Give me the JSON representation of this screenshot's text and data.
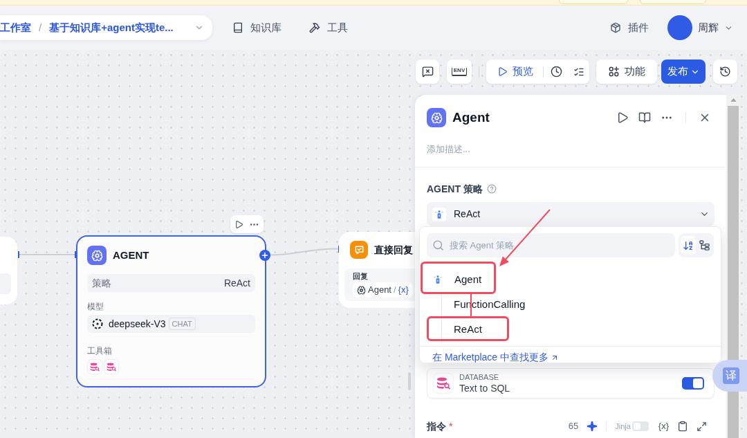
{
  "header": {
    "breadcrumb": [
      {
        "label": "工作室"
      },
      {
        "label": "基于知识库+agent实现te..."
      }
    ],
    "separator": "/",
    "nav": [
      {
        "label": "知识库"
      },
      {
        "label": "工具"
      }
    ],
    "plugins": {
      "label": "插件"
    },
    "user": {
      "name": "周辉"
    }
  },
  "toolbar": {
    "env": "ENV",
    "preview": "预览",
    "features": "功能",
    "publish": "发布"
  },
  "canvas": {
    "agent_node": {
      "title": "AGENT",
      "selected": true,
      "strategy_label": "策略",
      "strategy_value": "ReAct",
      "model_label": "模型",
      "model": "deepseek-V3",
      "model_badge": "CHAT",
      "toolbox_label": "工具箱"
    },
    "answer_node": {
      "title": "直接回复",
      "reply_label": "回复",
      "variable_source": "Agent",
      "variable_separator": "/",
      "variable_name": "{x}"
    }
  },
  "panel": {
    "title": "Agent",
    "description": {
      "placeholder": "添加描述..."
    },
    "strategy_label": "AGENT 策略",
    "strategy_value": "ReAct",
    "dropdown": {
      "search": {
        "placeholder": "搜索 Agent 策略"
      },
      "view_modes": [
        {
          "selected": true
        },
        {
          "selected": false
        }
      ],
      "options": [
        {
          "label": "Agent",
          "annotated": true,
          "children": [
            {
              "label": "FunctionCalling",
              "annotated": false
            },
            {
              "label": "ReAct",
              "annotated": true
            }
          ]
        }
      ],
      "marketplace_link": "在 Marketplace 中查找更多"
    },
    "tools": [
      {
        "category": "DATABASE",
        "name": "Text to SQL",
        "on": true
      }
    ],
    "instruction": {
      "label": "指令",
      "required_mark": "*",
      "count": "65",
      "jinja_label": "Jinja",
      "jinja_on": false,
      "variable_button": "{x}"
    }
  },
  "translate_button": {
    "label": "译"
  }
}
